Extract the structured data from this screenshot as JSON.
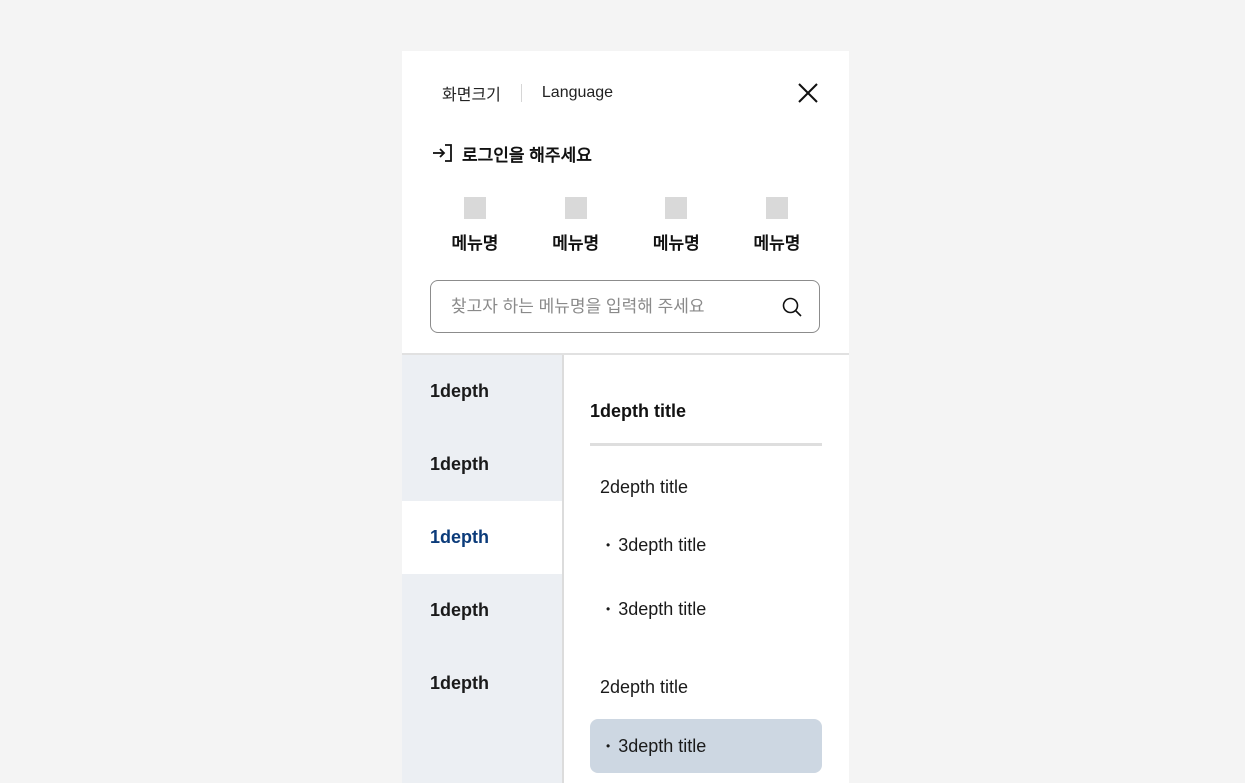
{
  "util": {
    "screen_size_label": "화면크기",
    "language_label": "Language"
  },
  "login": {
    "label": "로그인을 해주세요",
    "icon": "login-icon"
  },
  "quick_menu": [
    {
      "label": "메뉴명"
    },
    {
      "label": "메뉴명"
    },
    {
      "label": "메뉴명"
    },
    {
      "label": "메뉴명"
    }
  ],
  "search": {
    "placeholder": "찾고자 하는 메뉴명을 입력해 주세요",
    "value": ""
  },
  "depth1": [
    {
      "label": "1depth"
    },
    {
      "label": "1depth"
    },
    {
      "label": "1depth",
      "active": true
    },
    {
      "label": "1depth"
    },
    {
      "label": "1depth"
    }
  ],
  "content": {
    "depth1_title": "1depth title",
    "groups": [
      {
        "title": "2depth title",
        "items": [
          "3depth title",
          "3depth title"
        ]
      },
      {
        "title": "2depth title",
        "items": [
          "3depth title"
        ]
      }
    ],
    "bullet": "•"
  },
  "colors": {
    "accent": "#0b3b7a",
    "selected_bg": "#cdd7e2",
    "sidebar_bg": "#eceff3"
  }
}
